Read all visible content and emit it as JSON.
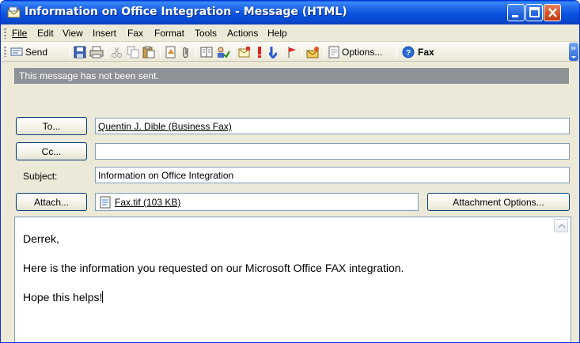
{
  "window": {
    "title": "Information on Office Integration - Message (HTML)",
    "colors": {
      "titlebar": "#0b54de",
      "banner": "#8e9196"
    }
  },
  "menu": {
    "items": [
      {
        "label": "File"
      },
      {
        "label": "Edit"
      },
      {
        "label": "View"
      },
      {
        "label": "Insert"
      },
      {
        "label": "Format"
      },
      {
        "label": "Fax"
      },
      {
        "label": "Tools"
      },
      {
        "label": "Actions"
      },
      {
        "label": "Help"
      }
    ]
  },
  "toolbar": {
    "send_label": "Send",
    "options_label": "Options...",
    "fax_label": "Fax",
    "icons": [
      "send-icon",
      "save-icon",
      "print-icon",
      "cut-icon",
      "copy-icon",
      "paste-icon",
      "insert-file-icon",
      "attach-icon",
      "address-book-icon",
      "check-names-icon",
      "flag-icon",
      "importance-high-icon",
      "importance-low-icon",
      "follow-up-icon",
      "permission-icon",
      "options-icon",
      "help-icon",
      "fax-icon"
    ]
  },
  "form": {
    "banner": "This message has not been sent.",
    "to_button": "To...",
    "to_value": "Quentin J. Dible (Business Fax)",
    "cc_button": "Cc...",
    "cc_value": "",
    "subject_label": "Subject:",
    "subject_value": "Information on Office Integration",
    "attach_button": "Attach...",
    "attachment_name": "Fax.tif (103 KB)",
    "attachment_options_button": "Attachment Options..."
  },
  "body": {
    "lines": [
      "Derrek,",
      "Here is the information you requested on our Microsoft Office FAX integration.",
      "Hope this helps!"
    ]
  }
}
